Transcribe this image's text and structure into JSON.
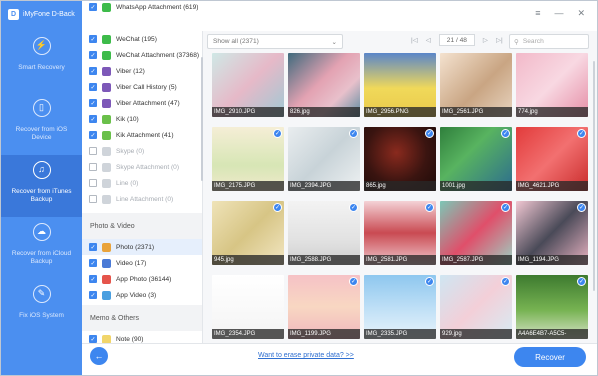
{
  "app": {
    "title": "iMyFone D-Back",
    "logo_letter": "D"
  },
  "window_controls": {
    "menu": "≡",
    "minimize": "—",
    "close": "✕"
  },
  "sidebar": {
    "items": [
      {
        "label": "Smart Recovery",
        "icon": "lightning-icon",
        "glyph": "⚡",
        "active": false
      },
      {
        "label": "Recover from iOS Device",
        "icon": "phone-icon",
        "glyph": "▯",
        "active": false
      },
      {
        "label": "Recover from iTunes Backup",
        "icon": "music-note-icon",
        "glyph": "♫",
        "active": true
      },
      {
        "label": "Recover from iCloud Backup",
        "icon": "cloud-icon",
        "glyph": "☁",
        "active": false
      },
      {
        "label": "Fix iOS System",
        "icon": "wrench-icon",
        "glyph": "✎",
        "active": false
      }
    ]
  },
  "categories": {
    "top_row": {
      "label": "WhatsApp Attachment (619)"
    },
    "items": [
      {
        "label": "WeChat (195)",
        "checked": true,
        "color": "#3dbb4a"
      },
      {
        "label": "WeChat Attachment (37368)",
        "checked": true,
        "color": "#3dbb4a"
      },
      {
        "label": "Viber (12)",
        "checked": true,
        "color": "#7d58b8"
      },
      {
        "label": "Viber Call History (5)",
        "checked": true,
        "color": "#7d58b8"
      },
      {
        "label": "Viber Attachment (47)",
        "checked": true,
        "color": "#7d58b8"
      },
      {
        "label": "Kik (10)",
        "checked": true,
        "color": "#6ac04a"
      },
      {
        "label": "Kik Attachment (41)",
        "checked": true,
        "color": "#6ac04a"
      },
      {
        "label": "Skype (0)",
        "checked": false,
        "disabled": true
      },
      {
        "label": "Skype Attachment (0)",
        "checked": false,
        "disabled": true
      },
      {
        "label": "Line (0)",
        "checked": false,
        "disabled": true
      },
      {
        "label": "Line Attachment (0)",
        "checked": false,
        "disabled": true
      }
    ],
    "section_photo": "Photo & Video",
    "photo_items": [
      {
        "label": "Photo (2371)",
        "checked": true,
        "color": "#e9a33b",
        "selected": true
      },
      {
        "label": "Video (17)",
        "checked": true,
        "color": "#4a7ad6"
      },
      {
        "label": "App Photo (36144)",
        "checked": true,
        "color": "#e5544b"
      },
      {
        "label": "App Video (3)",
        "checked": true,
        "color": "#4a9fe0"
      }
    ],
    "section_memo": "Memo & Others",
    "memo_items": [
      {
        "label": "Note (90)",
        "checked": true,
        "color": "#f1d56a"
      }
    ]
  },
  "toolbar": {
    "filter_label": "Show all (2371)",
    "page_indicator": "21 / 48",
    "search_placeholder": "Search"
  },
  "photos": [
    {
      "name": "IMG_2910.JPG",
      "checked": false,
      "bg": "linear-gradient(135deg,#cfe8e6 0%,#e6b9c8 50%,#9fc9d4 100%)"
    },
    {
      "name": "826.jpg",
      "checked": false,
      "bg": "linear-gradient(135deg,#3f6a7d 0%,#e3a2b2 45%,#e8c0cb 70%,#5a8ba0 100%)"
    },
    {
      "name": "IMG_2956.PNG",
      "checked": false,
      "bg": "linear-gradient(180deg,#5a86c9 0%,#f0d95a 55%,#e9c94a 100%)"
    },
    {
      "name": "IMG_2561.JPG",
      "checked": false,
      "bg": "linear-gradient(135deg,#f4e2cf 0%,#c9a583 55%,#e8d4bf 100%)"
    },
    {
      "name": "774.jpg",
      "checked": false,
      "bg": "linear-gradient(135deg,#f2b9c9 0%,#f8d8e2 50%,#e58ea6 100%)"
    },
    {
      "name": "IMG_2175.JPG",
      "checked": true,
      "bg": "linear-gradient(180deg,#f5eed6 0%,#d7e6b5 60%,#f1e9cc 100%)"
    },
    {
      "name": "IMG_2394.JPG",
      "checked": true,
      "bg": "linear-gradient(135deg,#e9edef 0%,#c8d3d8 50%,#eef1f2 100%)"
    },
    {
      "name": "865.jpg",
      "checked": true,
      "bg": "radial-gradient(circle at 45% 40%,#8a2a1e 0%,#3a1410 55%,#1c0a08 100%)"
    },
    {
      "name": "1001.jpg",
      "checked": true,
      "bg": "linear-gradient(135deg,#2f7f3c 0%,#58b360 40%,#2c6c8f 100%)"
    },
    {
      "name": "IMG_4621.JPG",
      "checked": true,
      "bg": "linear-gradient(135deg,#e23b3b 0%,#f27070 50%,#c92b2b 100%)"
    },
    {
      "name": "945.jpg",
      "checked": true,
      "bg": "linear-gradient(135deg,#efe3b8 0%,#d7c585 50%,#f2e6c2 100%)"
    },
    {
      "name": "IMG_2588.JPG",
      "checked": true,
      "bg": "linear-gradient(180deg,#f3f3f3 0%,#e2e2e2 60%,#cfcfcf 100%)"
    },
    {
      "name": "IMG_2581.JPG",
      "checked": true,
      "bg": "linear-gradient(180deg,#f4d2d6 0%,#c94a52 50%,#f0c8cd 100%)"
    },
    {
      "name": "IMG_2587.JPG",
      "checked": true,
      "bg": "linear-gradient(135deg,#7cc7b6 0%,#e04f6a 50%,#9bd2c4 100%)"
    },
    {
      "name": "IMG_1194.JPG",
      "checked": true,
      "bg": "linear-gradient(135deg,#f1c7d2 0%,#4a4a58 50%,#e9b3c2 100%)"
    },
    {
      "name": "IMG_2354.JPG",
      "checked": false,
      "bg": "linear-gradient(180deg,#ffffff 0%,#f4f4f4 100%)"
    },
    {
      "name": "IMG_1199.JPG",
      "checked": true,
      "bg": "linear-gradient(180deg,#f6c2c6 0%,#f8d7c2 50%,#f0b6bd 100%)"
    },
    {
      "name": "IMG_2335.JPG",
      "checked": true,
      "bg": "linear-gradient(180deg,#8ec7ef 0%,#c6e3f7 60%,#e8f3fb 100%)"
    },
    {
      "name": "929.jpg",
      "checked": true,
      "bg": "linear-gradient(135deg,#cfe6f2 0%,#f3cfd8 50%,#d7ecf4 100%)"
    },
    {
      "name": "A4A6E4B7-A5C5-",
      "checked": true,
      "bg": "linear-gradient(180deg,#3d7a2f 0%,#77b352 55%,#d8e3c9 100%)"
    }
  ],
  "footer": {
    "erase_link": "Want to erase private data? >>",
    "recover_button": "Recover",
    "back_glyph": "←"
  },
  "colors": {
    "accent": "#3d86ef",
    "sidebar": "#4b8ff0",
    "sidebar_active": "#3a78da"
  }
}
